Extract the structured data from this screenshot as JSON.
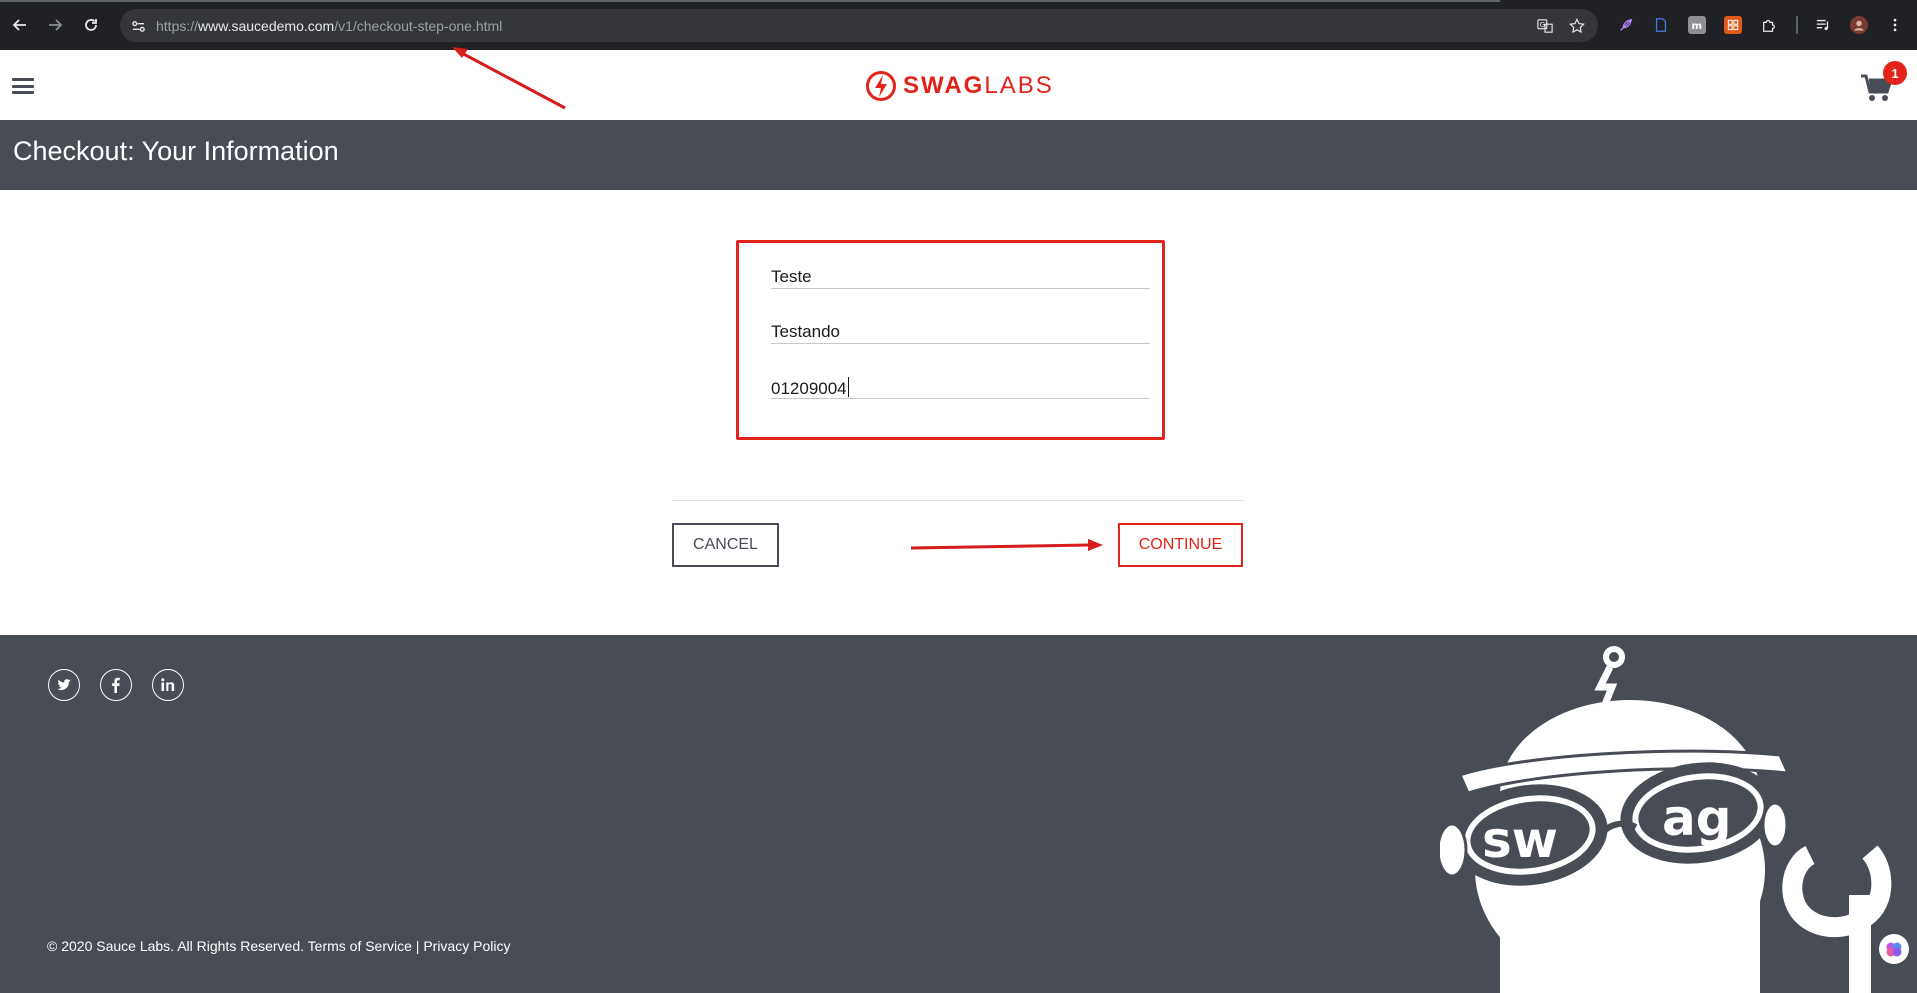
{
  "browser": {
    "url_scheme": "https://",
    "url_host": "www.saucedemo.com",
    "url_path": "/v1/checkout-step-one.html",
    "icons": [
      "back-arrow-icon",
      "forward-arrow-icon",
      "reload-icon",
      "site-info-icon",
      "translate-icon",
      "bookmark-star-icon",
      "extensions-puzzle-icon",
      "media-queue-icon",
      "profile-avatar-icon",
      "more-menu-icon"
    ]
  },
  "header": {
    "logo_bold": "SWAG",
    "logo_light": "LABS",
    "cart_count": "1",
    "brand_color": "#e2231a"
  },
  "subheader": {
    "title": "Checkout: Your Information"
  },
  "form": {
    "first_name": "Teste",
    "last_name": "Testando",
    "postal_code": "01209004"
  },
  "actions": {
    "cancel_label": "CANCEL",
    "continue_label": "CONTINUE"
  },
  "footer": {
    "copyright": "© 2020 Sauce Labs. All Rights Reserved. Terms of Service | Privacy Policy",
    "social": [
      "twitter-icon",
      "facebook-icon",
      "linkedin-icon"
    ],
    "background": "#474c55"
  }
}
